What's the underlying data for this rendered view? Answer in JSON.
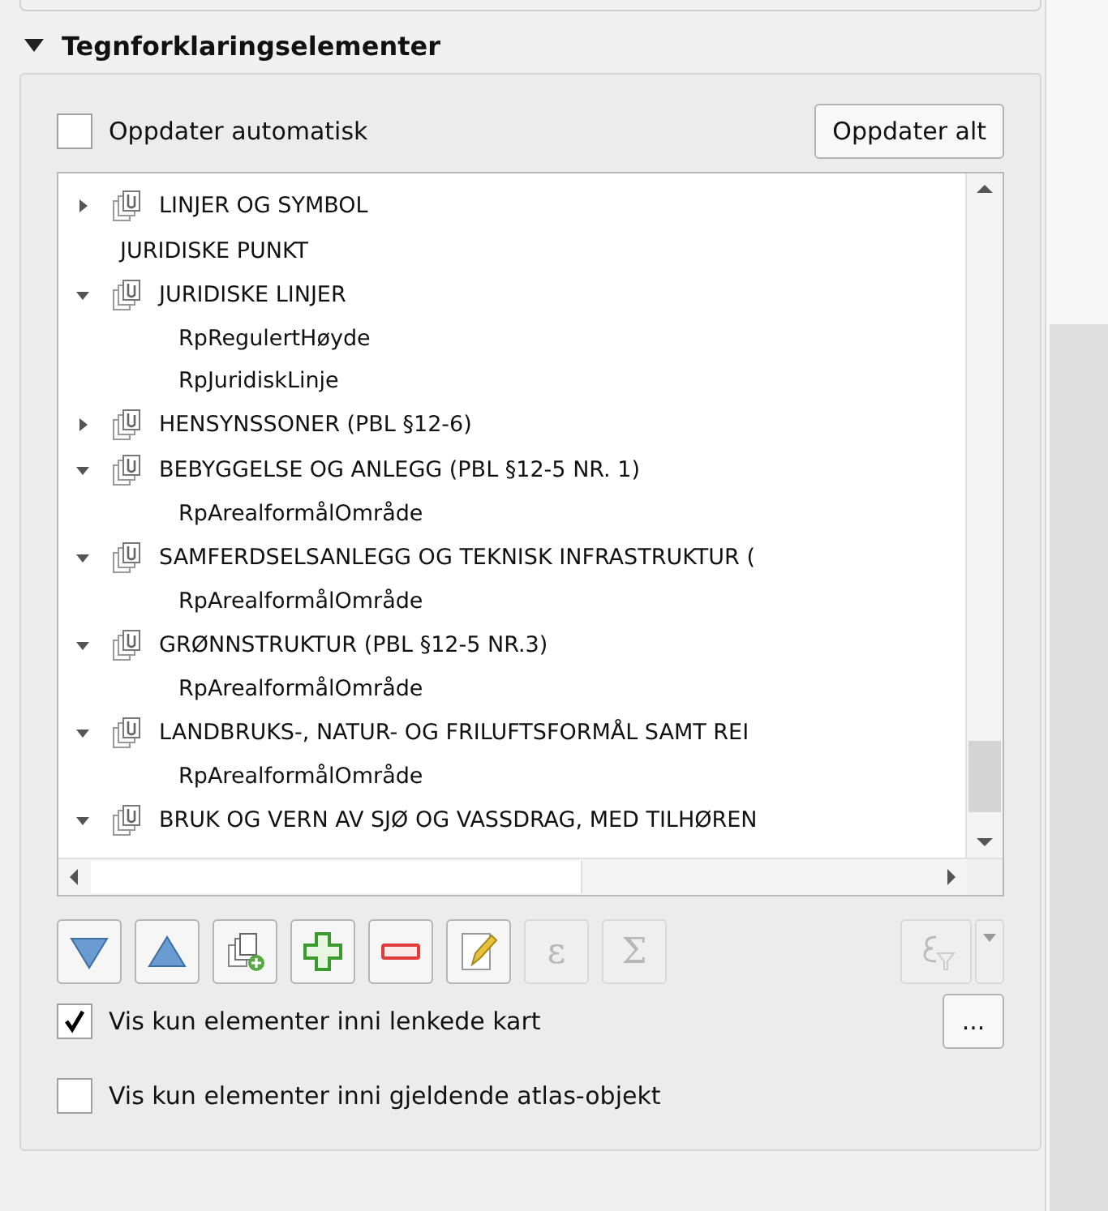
{
  "section": {
    "title": "Tegnforklaringselementer",
    "expanded": true
  },
  "auto_update": {
    "label": "Oppdater automatisk",
    "checked": false
  },
  "update_all_button": "Oppdater alt",
  "tree": [
    {
      "kind": "group",
      "label": "LINJER OG SYMBOL",
      "expanded": false
    },
    {
      "kind": "item",
      "label": "JURIDISKE PUNKT"
    },
    {
      "kind": "group",
      "label": "JURIDISKE LINJER",
      "expanded": true,
      "children": [
        {
          "label": "RpRegulertHøyde"
        },
        {
          "label": "RpJuridiskLinje"
        }
      ]
    },
    {
      "kind": "group",
      "label": "HENSYNSSONER (PBL §12-6)",
      "expanded": false
    },
    {
      "kind": "group",
      "label": "BEBYGGELSE OG ANLEGG (PBL §12-5 NR. 1)",
      "expanded": true,
      "children": [
        {
          "label": "RpArealformålOmråde"
        }
      ]
    },
    {
      "kind": "group",
      "label": "SAMFERDSELSANLEGG OG TEKNISK INFRASTRUKTUR (",
      "expanded": true,
      "children": [
        {
          "label": "RpArealformålOmråde"
        }
      ]
    },
    {
      "kind": "group",
      "label": "GRØNNSTRUKTUR (PBL §12-5 NR.3)",
      "expanded": true,
      "children": [
        {
          "label": "RpArealformålOmråde"
        }
      ]
    },
    {
      "kind": "group",
      "label": "LANDBRUKS-, NATUR- OG FRILUFTSFORMÅL SAMT REI",
      "expanded": true,
      "children": [
        {
          "label": "RpArealformålOmråde"
        }
      ]
    },
    {
      "kind": "group",
      "label": "BRUK OG VERN AV SJØ OG VASSDRAG, MED TILHØREN",
      "expanded": true
    }
  ],
  "toolbar": [
    {
      "kind": "down",
      "disabled": false
    },
    {
      "kind": "up",
      "disabled": false
    },
    {
      "kind": "add-group",
      "disabled": false
    },
    {
      "kind": "add",
      "disabled": false
    },
    {
      "kind": "remove",
      "disabled": false
    },
    {
      "kind": "edit",
      "disabled": false
    },
    {
      "kind": "glyph",
      "text": "ε",
      "disabled": true
    },
    {
      "kind": "glyph",
      "text": "Σ",
      "disabled": true
    }
  ],
  "filter_button": {
    "disabled": true
  },
  "options": [
    {
      "label": "Vis kun elementer inni lenkede kart",
      "checked": true,
      "button": "..."
    },
    {
      "label": "Vis kun elementer inni gjeldende atlas-objekt",
      "checked": false
    }
  ]
}
